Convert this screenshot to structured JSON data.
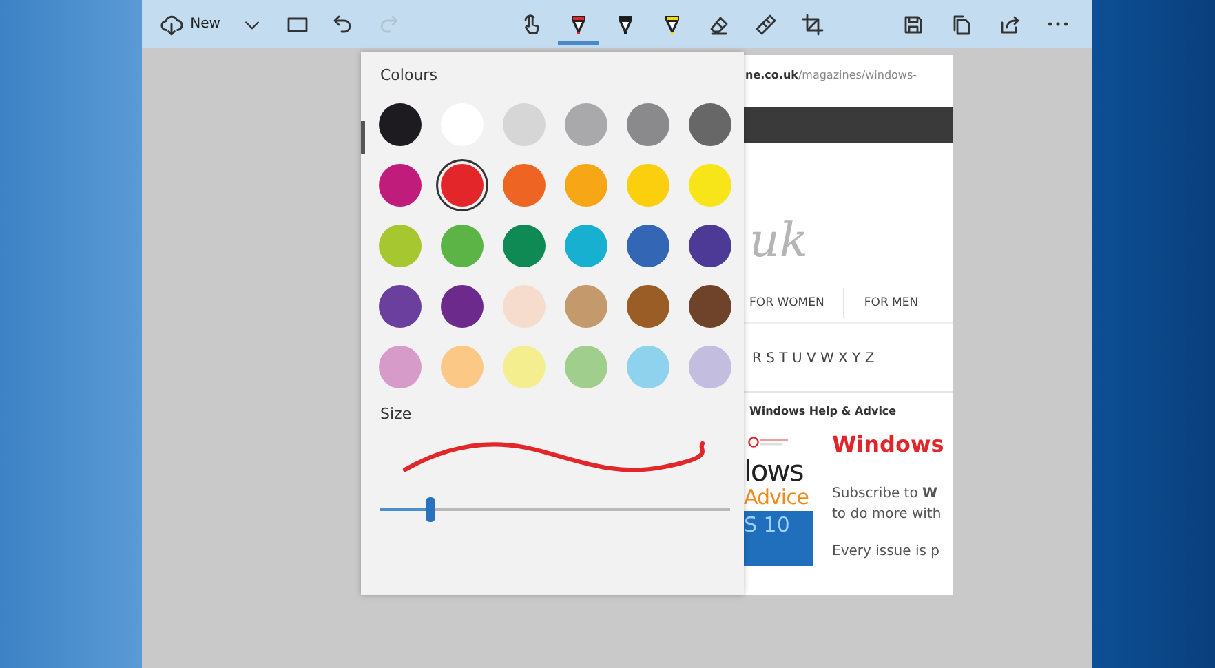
{
  "toolbar": {
    "new_label": "New",
    "left_tools": [
      {
        "kind": "caret",
        "disabled": false
      },
      {
        "kind": "window",
        "disabled": false
      },
      {
        "kind": "undo",
        "disabled": false
      },
      {
        "kind": "redo",
        "disabled": true
      }
    ],
    "center_tools": [
      {
        "kind": "touch",
        "selected": false
      },
      {
        "kind": "pen",
        "color": "#e0262a",
        "selected": true
      },
      {
        "kind": "pen",
        "color": "#1a1a1a",
        "selected": false
      },
      {
        "kind": "pen",
        "color": "#f5d800",
        "selected": false
      },
      {
        "kind": "eraser",
        "selected": false
      },
      {
        "kind": "ruler",
        "selected": false
      },
      {
        "kind": "crop",
        "selected": false
      }
    ],
    "right_tools": [
      {
        "kind": "save"
      },
      {
        "kind": "copy"
      },
      {
        "kind": "share"
      },
      {
        "kind": "more"
      }
    ]
  },
  "colour_panel": {
    "title": "Colours",
    "size_label": "Size",
    "level": 0.14,
    "swatches": [
      {
        "color": "#1d1b1f",
        "selected": false
      },
      {
        "color": "#ffffff",
        "selected": false
      },
      {
        "color": "#d6d6d6",
        "selected": false
      },
      {
        "color": "#a9a9ab",
        "selected": false
      },
      {
        "color": "#8a8a8c",
        "selected": false
      },
      {
        "color": "#676767",
        "selected": false
      },
      {
        "color": "#c01c7c",
        "selected": false
      },
      {
        "color": "#e2262a",
        "selected": true
      },
      {
        "color": "#ee6423",
        "selected": false
      },
      {
        "color": "#f7a716",
        "selected": false
      },
      {
        "color": "#fbcf0e",
        "selected": false
      },
      {
        "color": "#f7e51a",
        "selected": false
      },
      {
        "color": "#a6c72f",
        "selected": false
      },
      {
        "color": "#5bb445",
        "selected": false
      },
      {
        "color": "#0f8a55",
        "selected": false
      },
      {
        "color": "#17b0d1",
        "selected": false
      },
      {
        "color": "#3466b6",
        "selected": false
      },
      {
        "color": "#4d3996",
        "selected": false
      },
      {
        "color": "#6a3f9d",
        "selected": false
      },
      {
        "color": "#6c2a8c",
        "selected": false
      },
      {
        "color": "#f6dccc",
        "selected": false
      },
      {
        "color": "#c49a6c",
        "selected": false
      },
      {
        "color": "#9b5d26",
        "selected": false
      },
      {
        "color": "#6e432a",
        "selected": false
      },
      {
        "color": "#d79bc9",
        "selected": false
      },
      {
        "color": "#fbc985",
        "selected": false
      },
      {
        "color": "#f4ee8e",
        "selected": false
      },
      {
        "color": "#a0ce8d",
        "selected": false
      },
      {
        "color": "#8fd2ee",
        "selected": false
      },
      {
        "color": "#c3bde0",
        "selected": false
      }
    ]
  },
  "web_page": {
    "address": "**ne.co.uk**/magazines/windows-",
    "logo_text": "uk",
    "nav": [
      "FOR WOMEN",
      "FOR MEN"
    ],
    "letters": "R S T U V W X Y Z",
    "section_title": "Windows Help & Advice",
    "cover": {
      "line_1": "lows",
      "line_2": "Advice",
      "line_3": "S 10"
    },
    "headline": "Windows",
    "body": [
      "Subscribe to **W**",
      "to do more with",
      "Every issue is p"
    ]
  }
}
